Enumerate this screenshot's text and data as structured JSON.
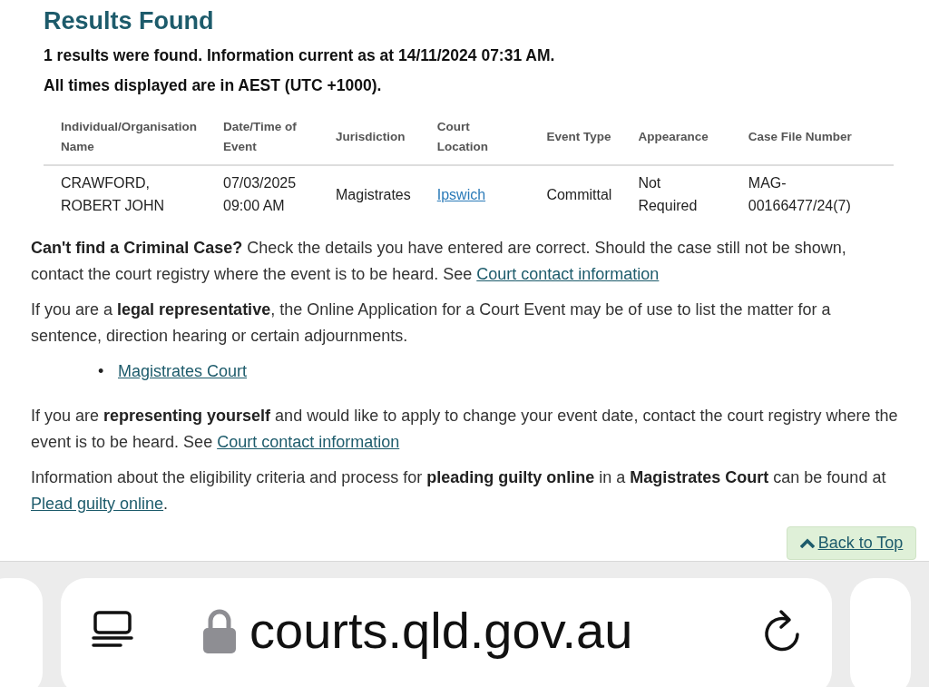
{
  "heading": "Results Found",
  "summary": [
    "1 results were found. Information current as at 14/11/2024 07:31 AM.",
    "All times displayed are in AEST (UTC +1000)."
  ],
  "table": {
    "columns": [
      "Individual/Organisation Name",
      "Date/Time of Event",
      "Jurisdiction",
      "Court Location",
      "Event Type",
      "Appearance",
      "Case File Number"
    ],
    "rows": [
      [
        {
          "text": "CRAWFORD, ROBERT JOHN",
          "kind": "text"
        },
        {
          "text": "07/03/2025 09:00 AM",
          "kind": "text"
        },
        {
          "text": "Magistrates",
          "kind": "text"
        },
        {
          "text": "Ipswich",
          "kind": "link"
        },
        {
          "text": "Committal",
          "kind": "text"
        },
        {
          "text": "Not Required",
          "kind": "text"
        },
        {
          "text": "MAG-00166477/24(7)",
          "kind": "text"
        }
      ]
    ]
  },
  "paragraphs": [
    {
      "kind": "text",
      "parts": [
        {
          "kind": "bold",
          "text": "Can't find a Criminal Case?"
        },
        {
          "kind": "text",
          "text": " Check the details you have entered are correct. Should the case still not be shown, contact the court registry where the event is to be heard. See "
        },
        {
          "kind": "link",
          "text": "Court contact information"
        }
      ]
    },
    {
      "kind": "text",
      "parts": [
        {
          "kind": "text",
          "text": "If you are a "
        },
        {
          "kind": "bold",
          "text": "legal representative"
        },
        {
          "kind": "text",
          "text": ", the Online Application for a Court Event may be of use to list the matter for a sentence, direction hearing or certain adjournments."
        }
      ]
    },
    {
      "kind": "bullet",
      "marker": "•",
      "parts": [
        {
          "kind": "link",
          "text": "Magistrates Court"
        }
      ]
    },
    {
      "kind": "text",
      "parts": [
        {
          "kind": "text",
          "text": "If you are "
        },
        {
          "kind": "bold",
          "text": "representing yourself"
        },
        {
          "kind": "text",
          "text": " and would like to apply to change your event date, contact the court registry where the event is to be heard. See "
        },
        {
          "kind": "link",
          "text": "Court contact information"
        }
      ]
    },
    {
      "kind": "text",
      "parts": [
        {
          "kind": "text",
          "text": "Information about the eligibility criteria and process for "
        },
        {
          "kind": "bold",
          "text": "pleading guilty online"
        },
        {
          "kind": "text",
          "text": " in a "
        },
        {
          "kind": "bold",
          "text": "Magistrates Court"
        },
        {
          "kind": "text",
          "text": " can be found at "
        },
        {
          "kind": "link",
          "text": "Plead guilty online"
        },
        {
          "kind": "text",
          "text": "."
        }
      ]
    }
  ],
  "back_to_top": "Back to Top",
  "address_bar": {
    "url": "courts.qld.gov.au"
  }
}
